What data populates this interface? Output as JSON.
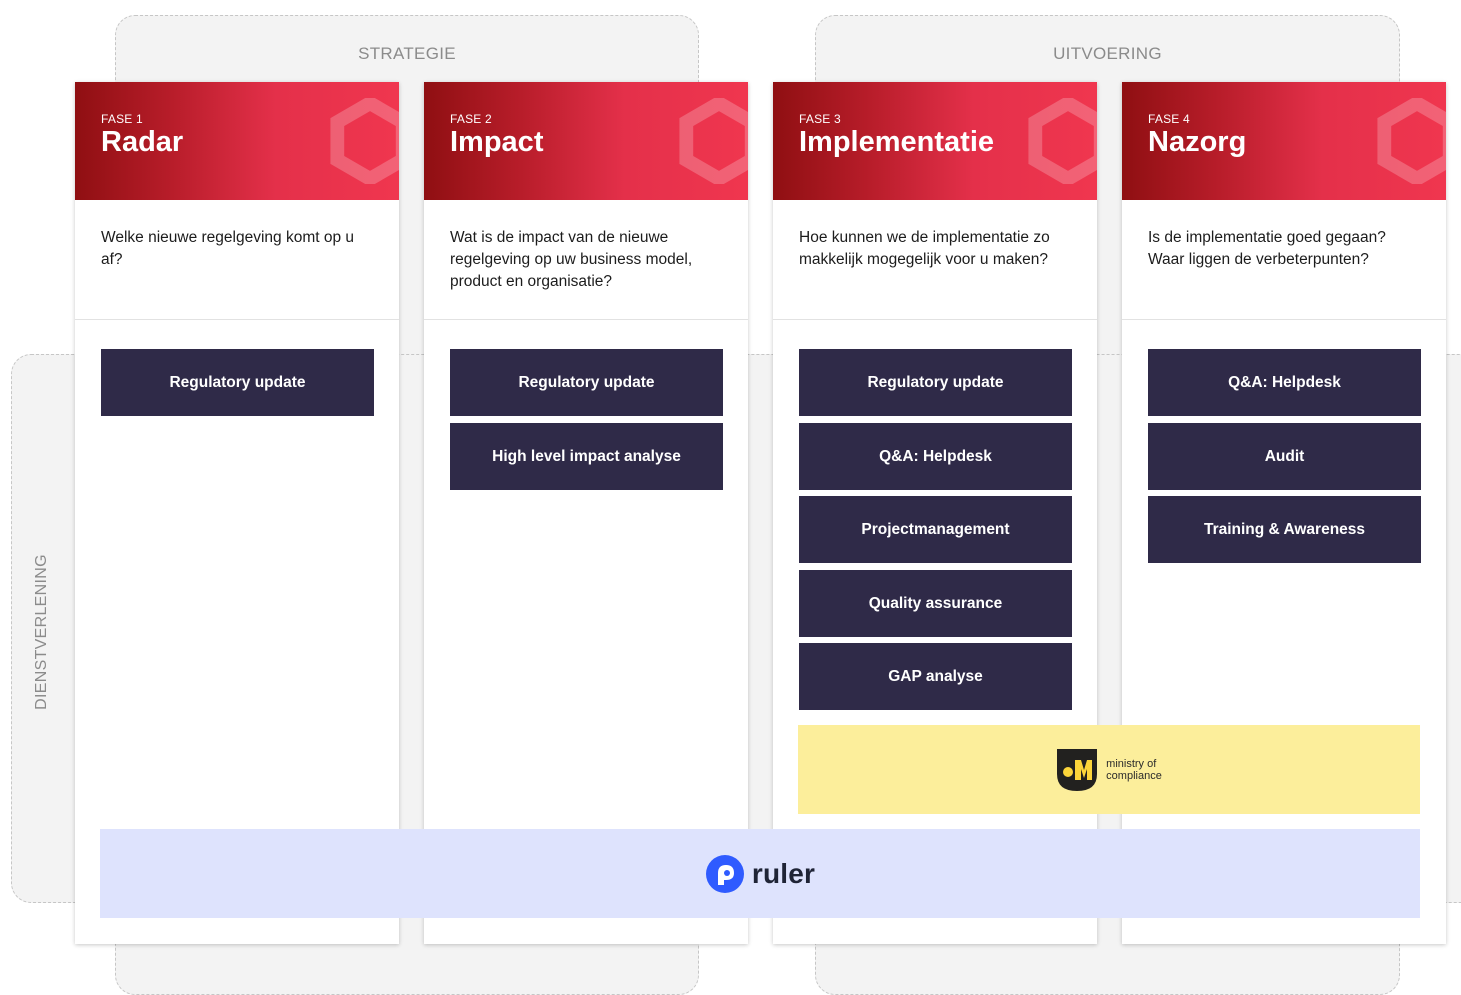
{
  "groups": {
    "strategie": "STRATEGIE",
    "uitvoering": "UITVOERING",
    "dienstverlening": "DIENSTVERLENING"
  },
  "phases": [
    {
      "label": "FASE 1",
      "title": "Radar",
      "question": "Welke nieuwe regelgeving komt op u af?",
      "services": [
        "Regulatory update"
      ]
    },
    {
      "label": "FASE 2",
      "title": "Impact",
      "question": "Wat is de impact van de nieuwe regelgeving op uw business model, product en organisatie?",
      "services": [
        "Regulatory update",
        "High level impact analyse"
      ]
    },
    {
      "label": "FASE 3",
      "title": "Implementatie",
      "question": "Hoe kunnen we de implementatie zo makkelijk mogegelijk voor u maken?",
      "services": [
        "Regulatory update",
        "Q&A: Helpdesk",
        "Projectmanagement",
        "Quality assurance",
        "GAP analyse"
      ]
    },
    {
      "label": "FASE 4",
      "title": "Nazorg",
      "question": "Is de implementatie goed gegaan? Waar liggen de verbeterpunten?",
      "services": [
        "Q&A: Helpdesk",
        "Audit",
        "Training & Awareness"
      ]
    }
  ],
  "partners": {
    "ministry_of_compliance": {
      "line1": "ministry of",
      "line2": "compliance"
    },
    "ruler": "ruler"
  },
  "colors": {
    "header_dark": "#8f0f12",
    "header_light": "#f0364f",
    "service_bg": "#2f2a48",
    "moc_bg": "#fcee9b",
    "ruler_bg": "#dee3fd",
    "ruler_accent": "#2f5bff"
  },
  "icons": [
    "hexagon-deco-icon",
    "ministry-of-compliance-logo-icon",
    "ruler-logo-icon"
  ]
}
